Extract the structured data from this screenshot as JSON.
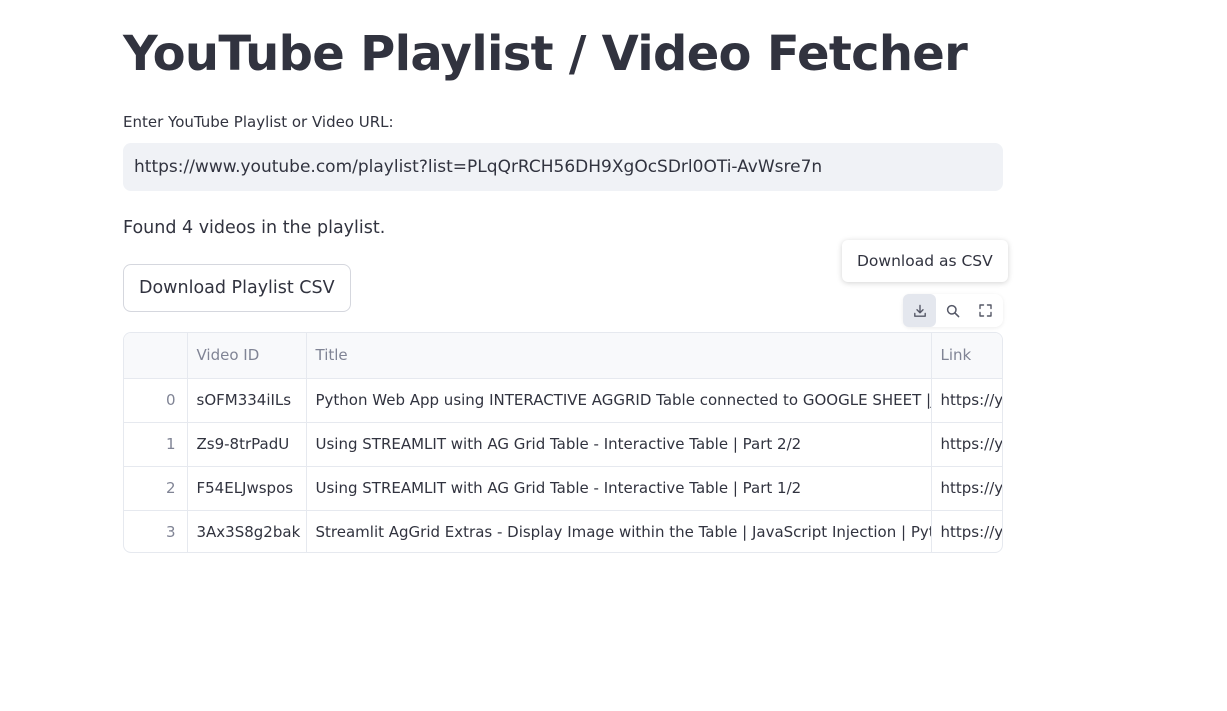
{
  "title": "YouTube Playlist / Video Fetcher",
  "input": {
    "label": "Enter YouTube Playlist or Video URL:",
    "value": "https://www.youtube.com/playlist?list=PLqQrRCH56DH9XgOcSDrl0OTi-AvWsre7n"
  },
  "status_text": "Found 4 videos in the playlist.",
  "download_button": "Download Playlist CSV",
  "tooltip": "Download as CSV",
  "toolbar": {
    "icons": [
      "download-icon",
      "search-icon",
      "fullscreen-icon"
    ]
  },
  "table": {
    "headers": [
      "",
      "Video ID",
      "Title",
      "Link"
    ],
    "rows": [
      {
        "index": "0",
        "video_id": "sOFM334iILs",
        "title": "Python Web App using INTERACTIVE AGGRID Table connected to GOOGLE SHEET |JavaScript",
        "link": "https://y"
      },
      {
        "index": "1",
        "video_id": "Zs9-8trPadU",
        "title": "Using STREAMLIT with AG Grid Table - Interactive Table | Part 2/2",
        "link": "https://y"
      },
      {
        "index": "2",
        "video_id": "F54ELJwspos",
        "title": "Using STREAMLIT with AG Grid Table - Interactive Table | Part 1/2",
        "link": "https://y"
      },
      {
        "index": "3",
        "video_id": "3Ax3S8g2bak",
        "title": "Streamlit AgGrid Extras - Display Image within the Table | JavaScript Injection | Python",
        "link": "https://y"
      }
    ]
  },
  "colors": {
    "text": "#31333f",
    "muted": "#808495",
    "input_bg": "#f0f2f6",
    "border": "#e6e9ef"
  }
}
